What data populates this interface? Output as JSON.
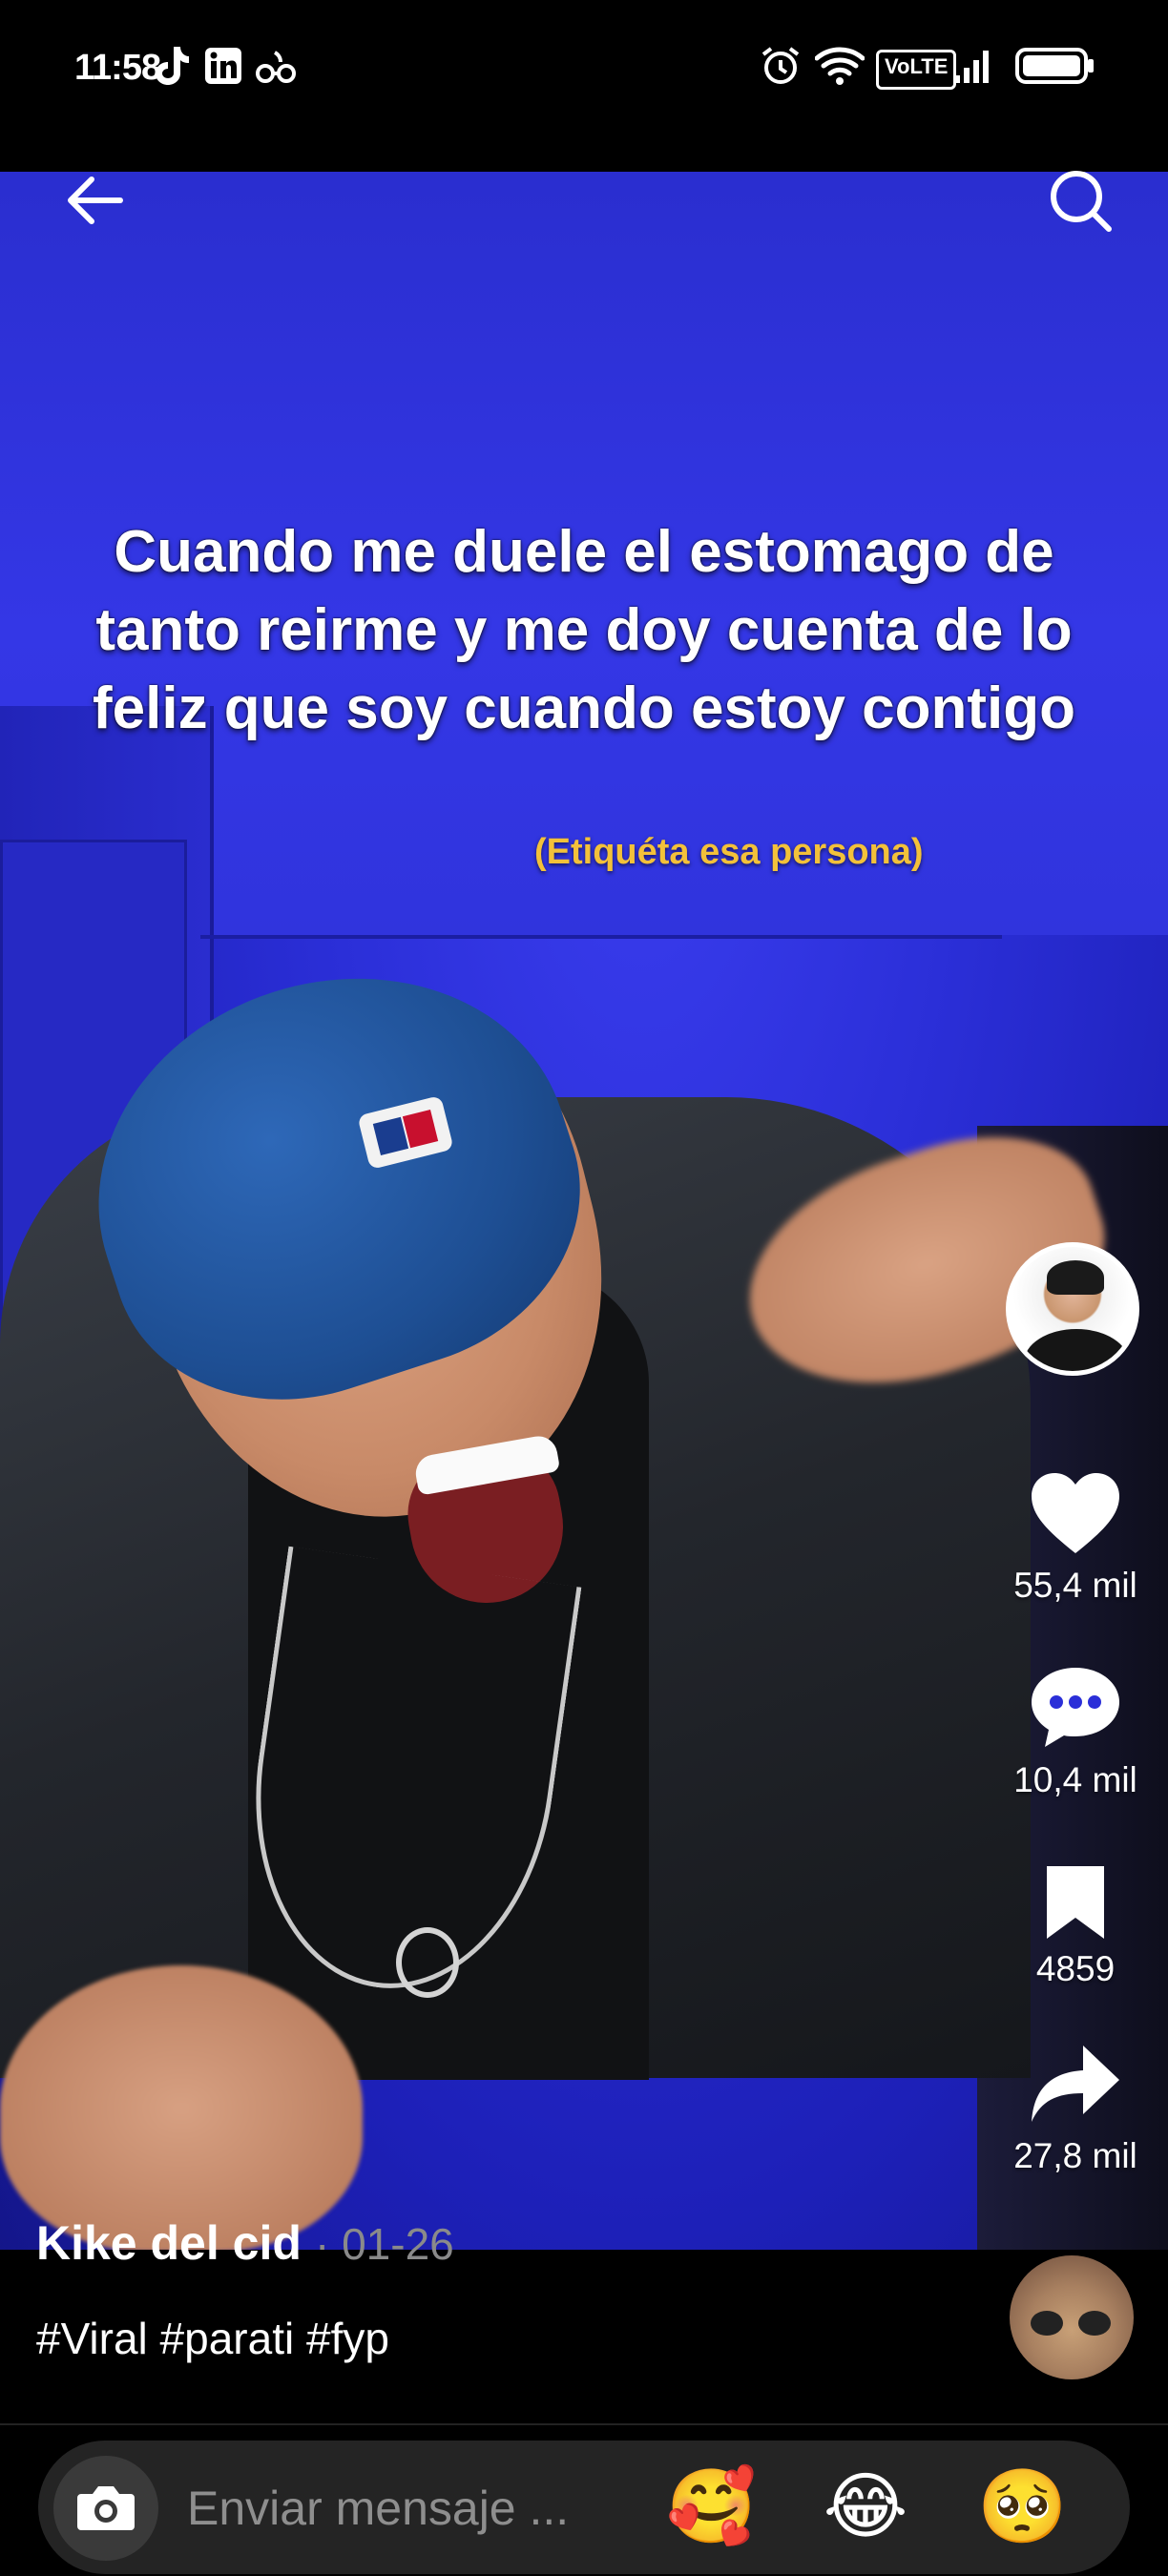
{
  "status_bar": {
    "time": "11:58",
    "volte": "VoLTE"
  },
  "video": {
    "caption_main": "Cuando me duele el estomago de tanto reirme y me doy cuenta de lo feliz que soy cuando estoy contigo",
    "caption_sub": "(Etiquéta esa persona)"
  },
  "actions": {
    "likes": "55,4 mil",
    "comments": "10,4 mil",
    "saves": "4859",
    "shares": "27,8 mil"
  },
  "post": {
    "author": "Kike del cid",
    "date": "· 01-26",
    "hashtags": "#Viral #parati #fyp"
  },
  "message_bar": {
    "placeholder": "Enviar mensaje ...",
    "emojis": [
      "🥰",
      "😂",
      "🥺"
    ]
  },
  "colors": {
    "background": "#000000",
    "video_blue": "#2b2fd8",
    "caption_sub": "#f3c13a",
    "message_bar": "#242424"
  }
}
